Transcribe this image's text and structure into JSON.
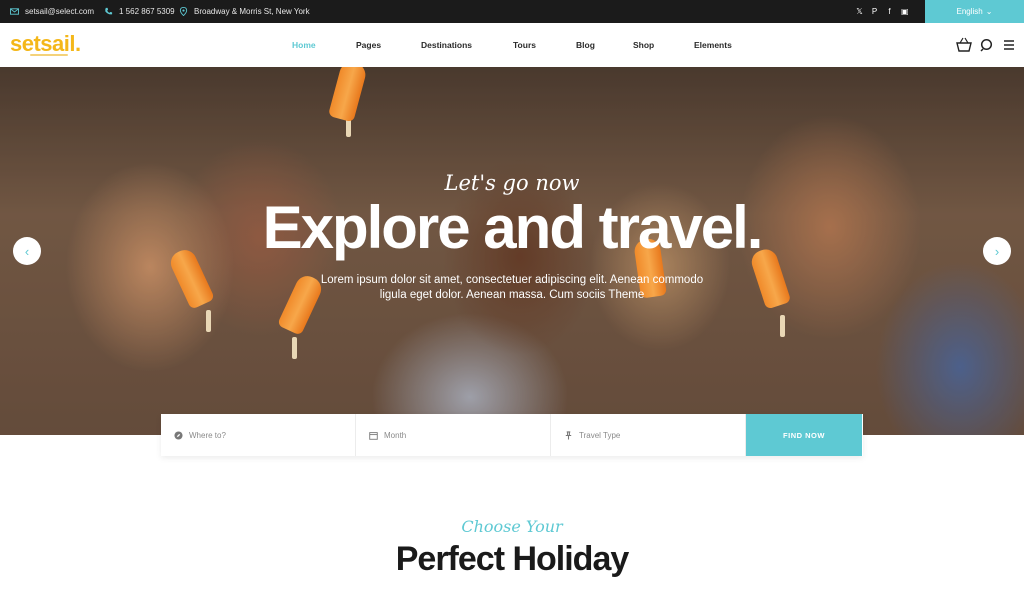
{
  "topbar": {
    "email": "setsail@select.com",
    "phone": "1 562 867 5309",
    "address": "Broadway & Morris St, New York",
    "socials": [
      "twitter-icon",
      "pinterest-icon",
      "facebook-icon",
      "instagram-icon"
    ],
    "language": "English"
  },
  "header": {
    "logo": "setsail.",
    "nav": [
      "Home",
      "Pages",
      "Destinations",
      "Tours",
      "Blog",
      "Shop",
      "Elements"
    ],
    "active_nav": "Home",
    "icons": [
      "basket-icon",
      "search-icon",
      "menu-icon"
    ]
  },
  "hero": {
    "subtitle": "Let's go now",
    "title": "Explore and travel.",
    "text_line1": "Lorem ipsum dolor sit amet, consectetuer adipiscing elit. Aenean commodo",
    "text_line2": "ligula eget dolor. Aenean massa. Cum sociis Theme"
  },
  "search": {
    "where_placeholder": "Where to?",
    "month_placeholder": "Month",
    "type_placeholder": "Travel Type",
    "button": "FIND NOW"
  },
  "section": {
    "subtitle": "Choose Your",
    "title": "Perfect Holiday"
  },
  "colors": {
    "accent": "#5ec9d3",
    "logo": "#f4b719",
    "topbar": "#1b1b1b"
  }
}
